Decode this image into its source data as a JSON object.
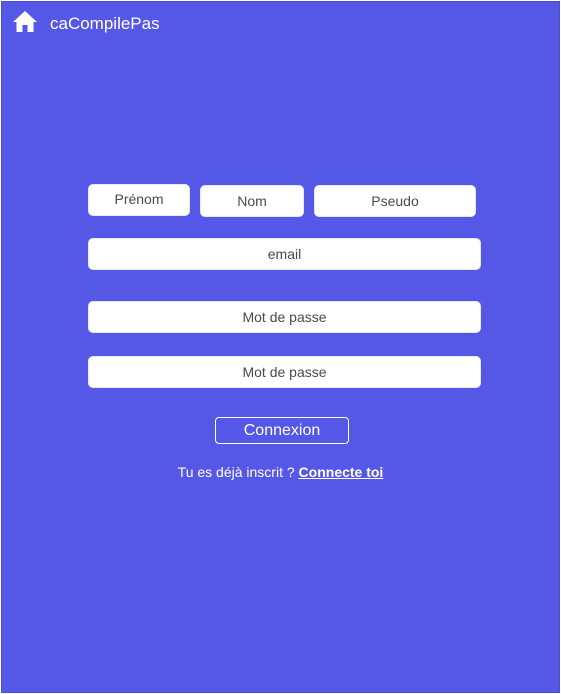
{
  "header": {
    "home_icon": "home-icon",
    "title": "caCompilePas"
  },
  "form": {
    "prenom_placeholder": "Prénom",
    "nom_placeholder": "Nom",
    "pseudo_placeholder": "Pseudo",
    "email_placeholder": "email",
    "password_placeholder": "Mot de passe",
    "password_confirm_placeholder": "Mot de passe",
    "submit_label": "Connexion"
  },
  "login_prompt": {
    "text": "Tu es déjà inscrit ? ",
    "link_label": "Connecte toi"
  },
  "colors": {
    "background": "#5558e6",
    "text_on_background": "#ffffff",
    "field_background": "#ffffff"
  }
}
